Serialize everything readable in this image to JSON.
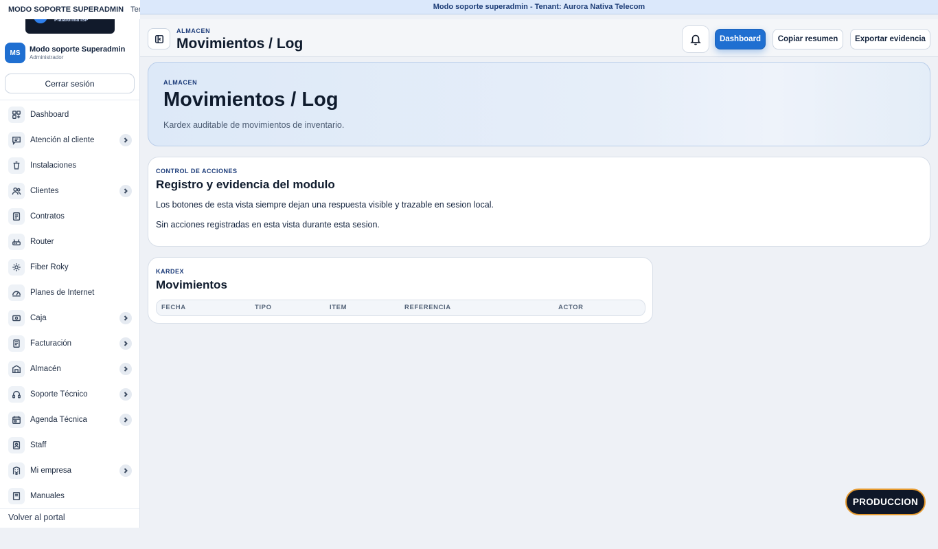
{
  "banner": {
    "left_text": "MODO SOPORTE SUPERADMIN",
    "left_tenant": "Tenant",
    "center_text": "Modo soporte superadmin - Tenant: Aurora Nativa Telecom"
  },
  "sidebar": {
    "logo_text": "Plataforma ISP",
    "profile": {
      "initials": "MS",
      "name": "Modo soporte Superadmin",
      "role": "Administrador"
    },
    "logout_label": "Cerrar sesión",
    "items": [
      {
        "label": "Dashboard",
        "icon": "dashboard-icon",
        "has_chevron": false
      },
      {
        "label": "Atención al cliente",
        "icon": "chat-icon",
        "has_chevron": true
      },
      {
        "label": "Instalaciones",
        "icon": "trash-icon",
        "has_chevron": false
      },
      {
        "label": "Clientes",
        "icon": "users-icon",
        "has_chevron": true
      },
      {
        "label": "Contratos",
        "icon": "document-icon",
        "has_chevron": false
      },
      {
        "label": "Router",
        "icon": "router-icon",
        "has_chevron": false
      },
      {
        "label": "Fiber Roky",
        "icon": "sun-icon",
        "has_chevron": false
      },
      {
        "label": "Planes de Internet",
        "icon": "gauge-icon",
        "has_chevron": false
      },
      {
        "label": "Caja",
        "icon": "cash-icon",
        "has_chevron": true
      },
      {
        "label": "Facturación",
        "icon": "invoice-icon",
        "has_chevron": true
      },
      {
        "label": "Almacén",
        "icon": "warehouse-icon",
        "has_chevron": true
      },
      {
        "label": "Soporte Técnico",
        "icon": "headset-icon",
        "has_chevron": true
      },
      {
        "label": "Agenda Técnica",
        "icon": "calendar-icon",
        "has_chevron": true
      },
      {
        "label": "Staff",
        "icon": "badge-icon",
        "has_chevron": false
      },
      {
        "label": "Mi empresa",
        "icon": "building-icon",
        "has_chevron": true
      },
      {
        "label": "Manuales",
        "icon": "book-icon",
        "has_chevron": false
      }
    ],
    "back_label": "Volver al portal"
  },
  "header": {
    "kicker": "ALMACEN",
    "title": "Movimientos / Log",
    "buttons": {
      "dashboard": "Dashboard",
      "copy": "Copiar resumen",
      "export": "Exportar evidencia"
    }
  },
  "hero": {
    "kicker": "ALMACEN",
    "title": "Movimientos / Log",
    "subtitle": "Kardex auditable de movimientos de inventario."
  },
  "control_card": {
    "kicker": "CONTROL DE ACCIONES",
    "title": "Registro y evidencia del modulo",
    "text1": "Los botones de esta vista siempre dejan una respuesta visible y trazable en sesion local.",
    "text2": "Sin acciones registradas en esta vista durante esta sesion."
  },
  "kardex_card": {
    "kicker": "KARDEX",
    "title": "Movimientos",
    "columns": [
      "FECHA",
      "TIPO",
      "ITEM",
      "REFERENCIA",
      "ACTOR"
    ]
  },
  "env_badge": "PRODUCCION",
  "colors": {
    "accent": "#1f6fd1",
    "badge_border": "#e69a2e",
    "dark": "#0f1728"
  }
}
